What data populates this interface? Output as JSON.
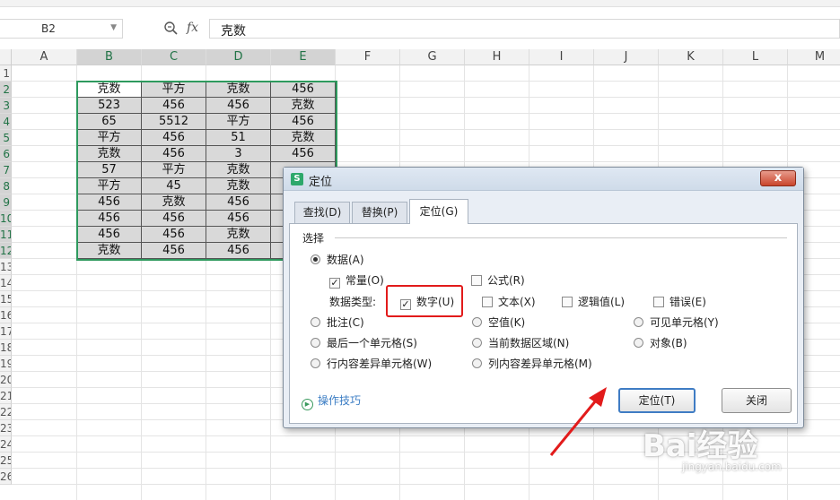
{
  "formula_bar": {
    "cell_ref": "B2",
    "zoom_icon": "zoom-icon",
    "fx_label": "fx",
    "content": "克数"
  },
  "columns": [
    "A",
    "B",
    "C",
    "D",
    "E",
    "F",
    "G",
    "H",
    "I",
    "J",
    "K",
    "L",
    "M"
  ],
  "selected_columns": [
    "B",
    "C",
    "D",
    "E"
  ],
  "rows": [
    "1",
    "2",
    "3",
    "4",
    "5",
    "6",
    "7",
    "8",
    "9",
    "10",
    "11",
    "12",
    "13",
    "14",
    "15",
    "16",
    "17",
    "18",
    "19",
    "20",
    "21",
    "22",
    "23",
    "24",
    "25",
    "26"
  ],
  "cells": [
    [
      "克数",
      "平方",
      "克数",
      "456"
    ],
    [
      "523",
      "456",
      "456",
      "克数"
    ],
    [
      "65",
      "5512",
      "平方",
      "456"
    ],
    [
      "平方",
      "456",
      "51",
      "克数"
    ],
    [
      "克数",
      "456",
      "3",
      "456"
    ],
    [
      "57",
      "平方",
      "克数",
      ""
    ],
    [
      "平方",
      "45",
      "克数",
      ""
    ],
    [
      "456",
      "克数",
      "456",
      ""
    ],
    [
      "456",
      "456",
      "456",
      ""
    ],
    [
      "456",
      "456",
      "克数",
      ""
    ],
    [
      "克数",
      "456",
      "456",
      ""
    ]
  ],
  "dialog": {
    "title": "定位",
    "close_label": "x",
    "tabs": [
      {
        "label": "查找(D)",
        "active": false
      },
      {
        "label": "替换(P)",
        "active": false
      },
      {
        "label": "定位(G)",
        "active": true
      }
    ],
    "group_label": "选择",
    "option_data": {
      "label": "数据(A)",
      "checked": true
    },
    "check_constant": {
      "label": "常量(O)",
      "checked": true
    },
    "check_formula": {
      "label": "公式(R)",
      "checked": false
    },
    "data_type_label": "数据类型:",
    "data_types": [
      {
        "label": "数字(U)",
        "checked": true
      },
      {
        "label": "文本(X)",
        "checked": false
      },
      {
        "label": "逻辑值(L)",
        "checked": false
      },
      {
        "label": "错误(E)",
        "checked": false
      }
    ],
    "radio_options": [
      {
        "label": "批注(C)",
        "checked": false
      },
      {
        "label": "空值(K)",
        "checked": false
      },
      {
        "label": "可见单元格(Y)",
        "checked": false
      },
      {
        "label": "最后一个单元格(S)",
        "checked": false
      },
      {
        "label": "当前数据区域(N)",
        "checked": false
      },
      {
        "label": "对象(B)",
        "checked": false
      },
      {
        "label": "行内容差异单元格(W)",
        "checked": false
      },
      {
        "label": "列内容差异单元格(M)",
        "checked": false
      }
    ],
    "tips_label": "操作技巧",
    "locate_button": "定位(T)",
    "close_button": "关闭"
  },
  "colors": {
    "selection": "#2e9a5e",
    "highlight": "#e21b1b",
    "arrow": "#e21b1b",
    "link": "#3b7dc4"
  },
  "watermark": {
    "main": "Bai经验",
    "sub": "jingyan.baidu.com"
  }
}
